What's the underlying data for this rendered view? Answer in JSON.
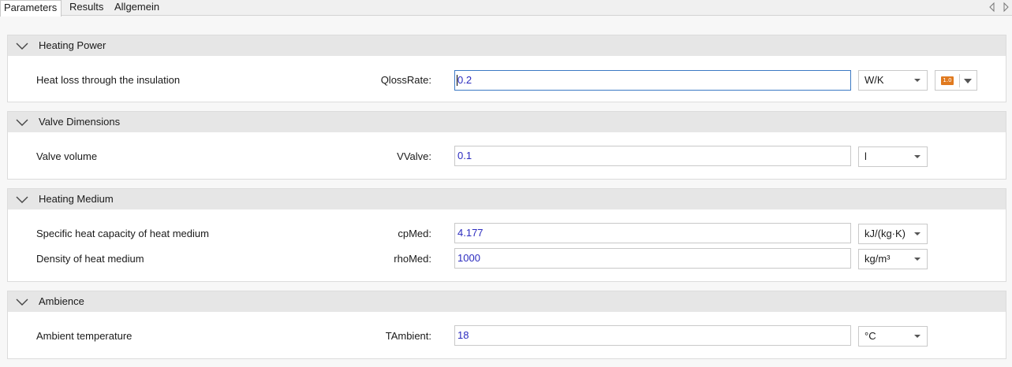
{
  "tabs": [
    {
      "label": "Parameters",
      "active": true
    },
    {
      "label": "Results",
      "active": false
    },
    {
      "label": "Allgemein",
      "active": false
    }
  ],
  "sections": {
    "heating_power": {
      "title": "Heating Power",
      "rows": [
        {
          "label": "Heat loss through the insulation",
          "var": "QlossRate:",
          "value": "0.2",
          "unit": "W/K",
          "expr_icon": "1.0"
        }
      ]
    },
    "valve_dimensions": {
      "title": "Valve Dimensions",
      "rows": [
        {
          "label": "Valve volume",
          "var": "VValve:",
          "value": "0.1",
          "unit": "l"
        }
      ]
    },
    "heating_medium": {
      "title": "Heating Medium",
      "rows": [
        {
          "label": "Specific heat capacity of heat medium",
          "var": "cpMed:",
          "value": "4.177",
          "unit": "kJ/(kg·K)"
        },
        {
          "label": "Density of heat medium",
          "var": "rhoMed:",
          "value": "1000",
          "unit": "kg/m³"
        }
      ]
    },
    "ambience": {
      "title": "Ambience",
      "rows": [
        {
          "label": "Ambient temperature",
          "var": "TAmbient:",
          "value": "18",
          "unit": "°C"
        }
      ]
    }
  },
  "colors": {
    "value_text": "#2b2bbf",
    "focus_border": "#3b79c4",
    "section_header": "#e6e6e6",
    "expr_icon": "#e07a1f"
  }
}
